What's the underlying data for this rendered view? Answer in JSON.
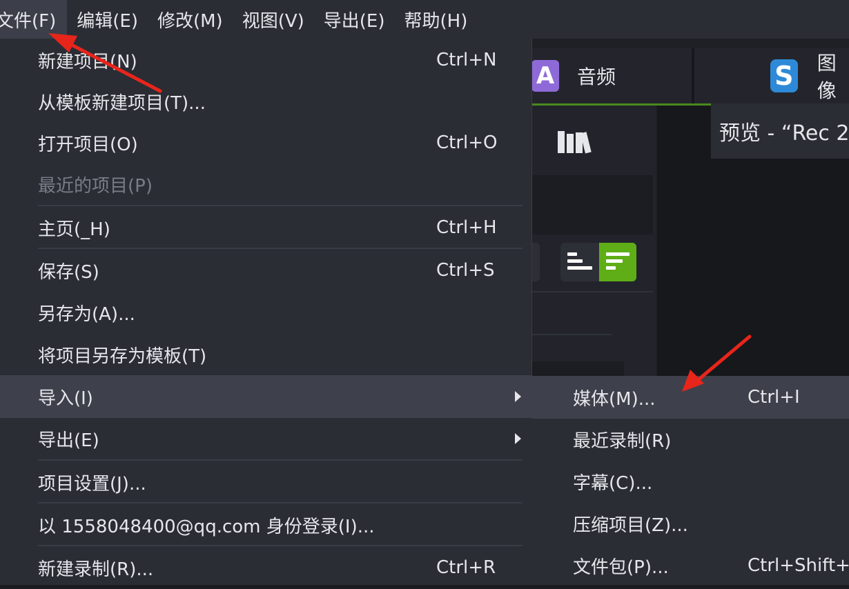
{
  "menubar": {
    "items": [
      "文件(F)",
      "编辑(E)",
      "修改(M)",
      "视图(V)",
      "导出(E)",
      "帮助(H)"
    ]
  },
  "tabs": {
    "audio_icon": "A",
    "audio_label": "音频",
    "second_icon": "S",
    "second_label": "图像"
  },
  "preview": {
    "title": "预览 - “Rec 2"
  },
  "file_menu": {
    "new_project": {
      "label": "新建项目(N)",
      "shortcut": "Ctrl+N"
    },
    "new_from_template": {
      "label": "从模板新建项目(T)..."
    },
    "open_project": {
      "label": "打开项目(O)",
      "shortcut": "Ctrl+O"
    },
    "recent_projects": {
      "label": "最近的项目(P)"
    },
    "home": {
      "label": "主页(_H)",
      "shortcut": "Ctrl+H"
    },
    "save": {
      "label": "保存(S)",
      "shortcut": "Ctrl+S"
    },
    "save_as": {
      "label": "另存为(A)..."
    },
    "save_as_template": {
      "label": "将项目另存为模板(T)"
    },
    "import": {
      "label": "导入(I)"
    },
    "export": {
      "label": "导出(E)"
    },
    "project_settings": {
      "label": "项目设置(J)..."
    },
    "sign_in": {
      "label": "以 1558048400@qq.com 身份登录(I)..."
    },
    "new_recording": {
      "label": "新建录制(R)...",
      "shortcut": "Ctrl+R"
    }
  },
  "import_submenu": {
    "media": {
      "label": "媒体(M)...",
      "shortcut": "Ctrl+I"
    },
    "recent_recordings": {
      "label": "最近录制(R)"
    },
    "captions": {
      "label": "字幕(C)..."
    },
    "zipped_project": {
      "label": "压缩项目(Z)..."
    },
    "library_package": {
      "label": "文件包(P)...",
      "shortcut": "Ctrl+Shift+P"
    }
  },
  "colors": {
    "menu_bg": "#2b2d35",
    "highlight": "#3e414b",
    "accent_green": "#5fae17",
    "annotation_red": "#e8251b"
  }
}
